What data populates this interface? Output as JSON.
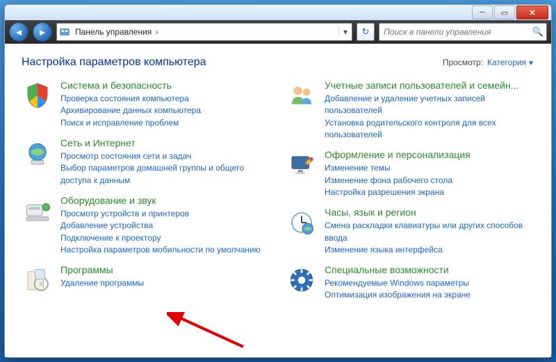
{
  "window": {
    "address": {
      "root": "Панель управления",
      "chevron": "›"
    },
    "search_placeholder": "Поиск в панели управления"
  },
  "header": {
    "title": "Настройка параметров компьютера",
    "view_label": "Просмотр:",
    "view_value": "Категория"
  },
  "left": [
    {
      "id": "system-security",
      "title": "Система и безопасность",
      "links": [
        "Проверка состояния компьютера",
        "Архивирование данных компьютера",
        "Поиск и исправление проблем"
      ]
    },
    {
      "id": "network-internet",
      "title": "Сеть и Интернет",
      "links": [
        "Просмотр состояния сети и задач",
        "Выбор параметров домашней группы и общего доступа к данным"
      ]
    },
    {
      "id": "hardware-sound",
      "title": "Оборудование и звук",
      "links": [
        "Просмотр устройств и принтеров",
        "Добавление устройства",
        "Подключение к проектору",
        "Настройка параметров мобильности по умолчанию"
      ]
    },
    {
      "id": "programs",
      "title": "Программы",
      "links": [
        "Удаление программы"
      ]
    }
  ],
  "right": [
    {
      "id": "user-accounts",
      "title": "Учетные записи пользователей и семейн...",
      "links": [
        "Добавление и удаление учетных записей пользователей",
        "Установка родительского контроля для всех пользователей"
      ]
    },
    {
      "id": "appearance",
      "title": "Оформление и персонализация",
      "links": [
        "Изменение темы",
        "Изменение фона рабочего стола",
        "Настройка разрешения экрана"
      ]
    },
    {
      "id": "clock-region",
      "title": "Часы, язык и регион",
      "links": [
        "Смена раскладки клавиатуры или других способов ввода",
        "Изменение языка интерфейса"
      ]
    },
    {
      "id": "ease-access",
      "title": "Специальные возможности",
      "links": [
        "Рекомендуемые Windows параметры",
        "Оптимизация изображения на экране"
      ]
    }
  ]
}
